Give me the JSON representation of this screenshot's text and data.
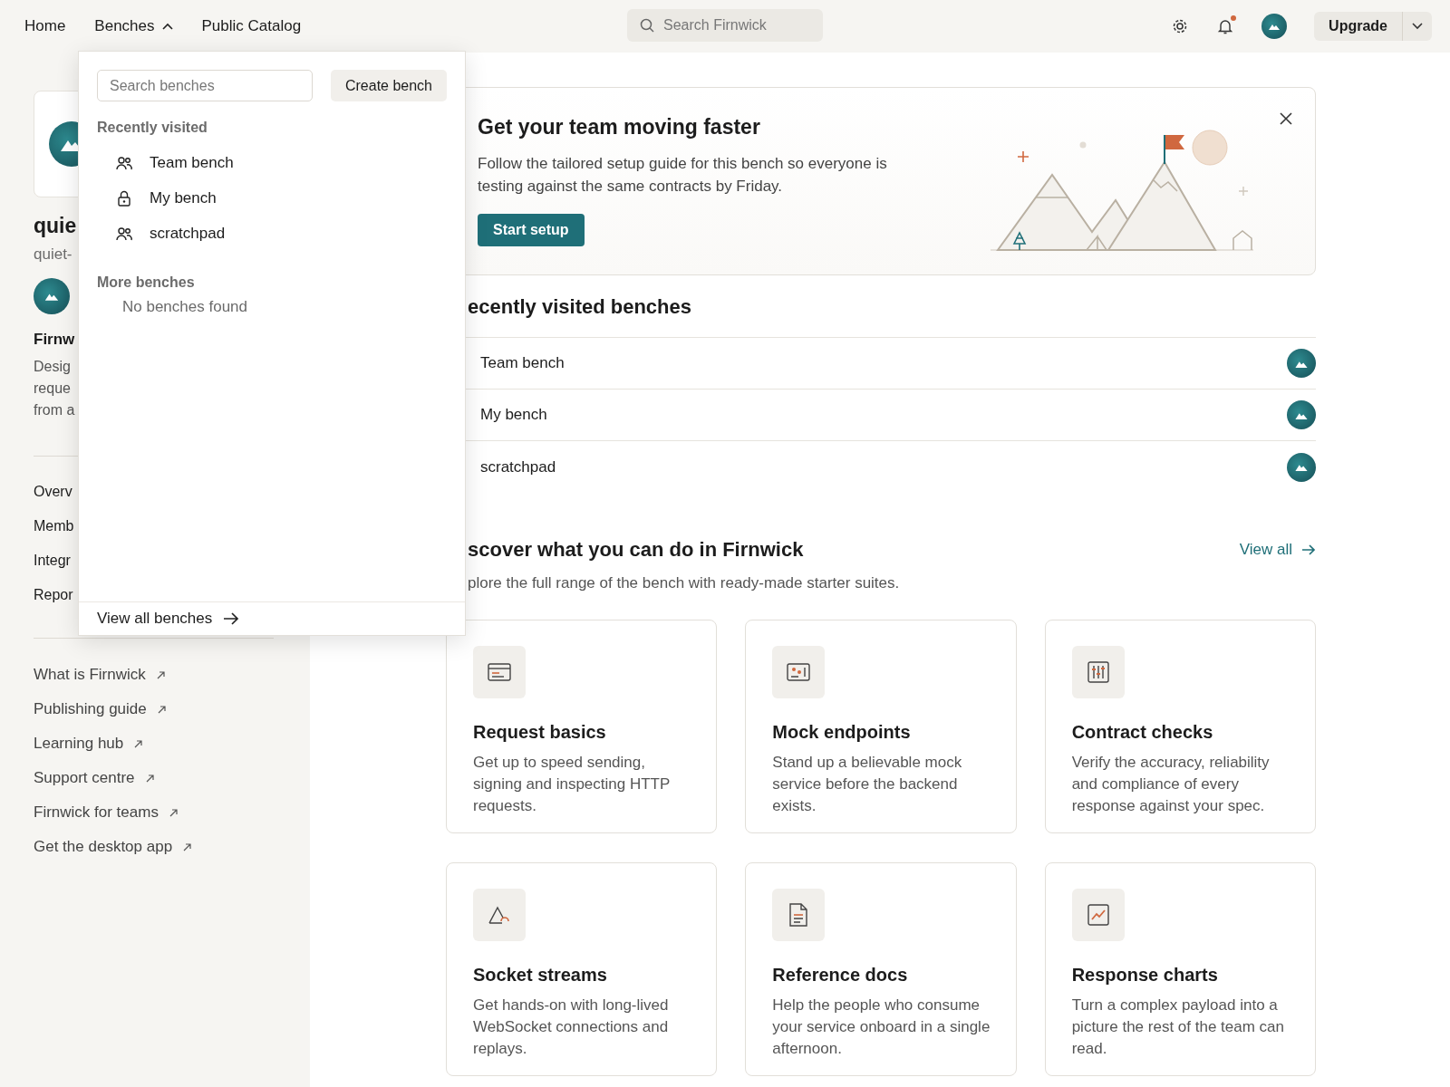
{
  "top_bar": {
    "home": {
      "label": "Home"
    },
    "benches": {
      "label": "Benches",
      "expanded": true
    },
    "public_catalog": {
      "label": "Public Catalog"
    },
    "search": {
      "placeholder": "Search Firnwick"
    },
    "notifications": {
      "unread": true
    },
    "upgrade": {
      "label": "Upgrade"
    }
  },
  "sidebar": {
    "workspace_name": "quie",
    "workspace_handle": "quiet-",
    "org_name": "Firnw",
    "org_description": [
      "Desig",
      "reque",
      "from a"
    ],
    "nav": [
      {
        "label": "Overv"
      },
      {
        "label": "Memb"
      },
      {
        "label": "Integr"
      },
      {
        "label": "Repor"
      }
    ],
    "links": [
      {
        "label": "What is Firnwick"
      },
      {
        "label": "Publishing guide"
      },
      {
        "label": "Learning hub"
      },
      {
        "label": "Support centre"
      },
      {
        "label": "Firnwick for teams"
      },
      {
        "label": "Get the desktop app"
      }
    ]
  },
  "benches_menu": {
    "search": {
      "placeholder": "Search benches"
    },
    "create_button": "Create bench",
    "recent_heading": "Recently visited",
    "recent": [
      {
        "label": "Team bench",
        "kind": "team"
      },
      {
        "label": "My bench",
        "kind": "private"
      },
      {
        "label": "scratchpad",
        "kind": "team"
      }
    ],
    "more_heading": "More benches",
    "empty_text": "No benches found",
    "view_all": "View all benches"
  },
  "banner": {
    "title": "Get your team moving faster",
    "text": "Follow the tailored setup guide for this bench so everyone is testing against the same contracts by Friday.",
    "button": "Start setup"
  },
  "recent_benches": {
    "heading": "ecently visited benches",
    "rows": [
      {
        "label": "Team bench"
      },
      {
        "label": "My bench"
      },
      {
        "label": "scratchpad"
      }
    ]
  },
  "discover": {
    "heading": "scover what you can do in Firnwick",
    "subtitle": "plore the full range of the bench with ready-made starter suites.",
    "view_all": "View all",
    "cards": [
      {
        "kind": "request",
        "title": "Request basics",
        "text": "Get up to speed sending, signing and inspecting HTTP requests."
      },
      {
        "kind": "mock",
        "title": "Mock endpoints",
        "text": "Stand up a believable mock service before the backend exists."
      },
      {
        "kind": "checks",
        "title": "Contract checks",
        "text": "Verify the accuracy, reliability and compliance of every response against your spec."
      },
      {
        "kind": "socket",
        "title": "Socket streams",
        "text": "Get hands-on with long-lived WebSocket connections and replays."
      },
      {
        "kind": "docs",
        "title": "Reference docs",
        "text": "Help the people who consume your service onboard in a single afternoon."
      },
      {
        "kind": "chart",
        "title": "Response charts",
        "text": "Turn a complex payload into a picture the rest of the team can read."
      }
    ]
  }
}
